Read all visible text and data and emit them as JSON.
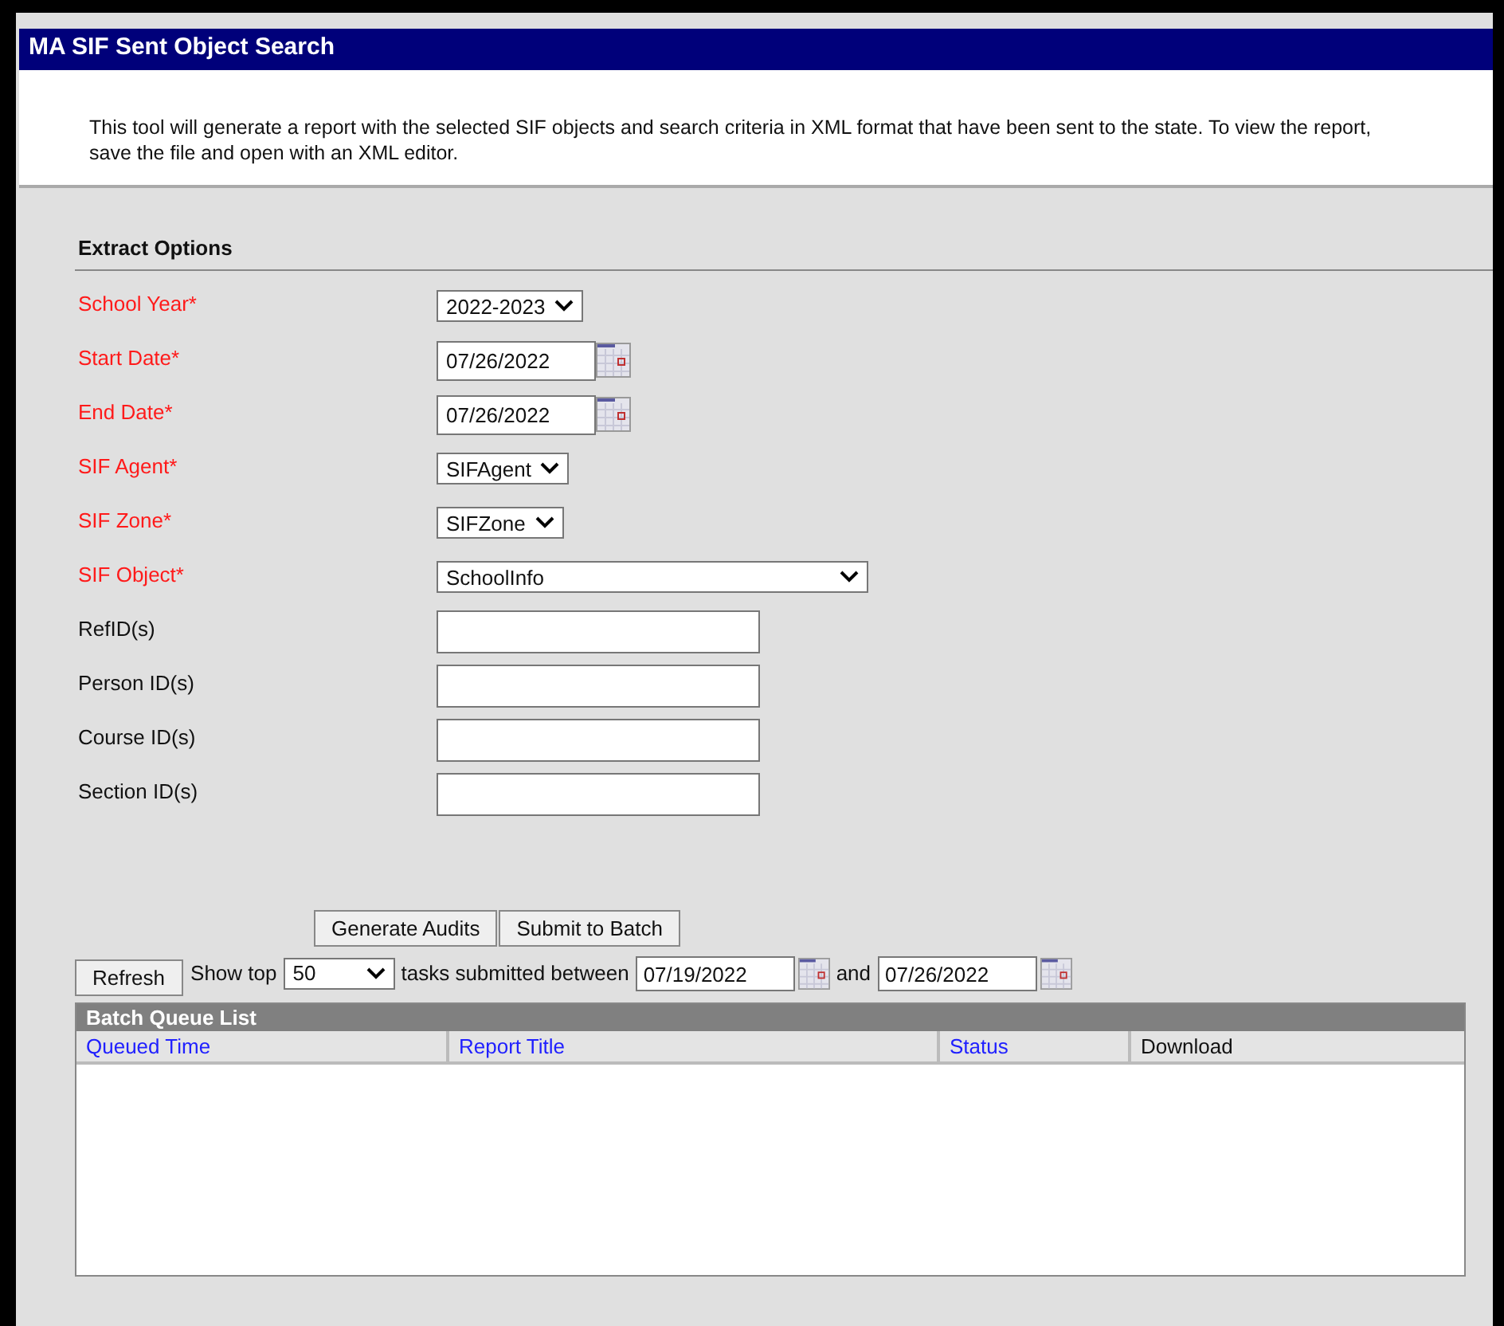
{
  "title": "MA SIF Sent Object Search",
  "description": "This tool will generate a report with the selected SIF objects and search criteria in XML format that have been sent to the state. To view the report, save the file and open with an XML editor.",
  "section_title": "Extract Options",
  "fields": [
    {
      "label": "School Year*",
      "required": true,
      "kind": "select",
      "value": "2022-2023"
    },
    {
      "label": "Start Date*",
      "required": true,
      "kind": "date",
      "value": "07/26/2022"
    },
    {
      "label": "End Date*",
      "required": true,
      "kind": "date",
      "value": "07/26/2022"
    },
    {
      "label": "SIF Agent*",
      "required": true,
      "kind": "select",
      "value": "SIFAgent"
    },
    {
      "label": "SIF Zone*",
      "required": true,
      "kind": "select",
      "value": "SIFZone"
    },
    {
      "label": "SIF Object*",
      "required": true,
      "kind": "wideselect",
      "value": "SchoolInfo"
    },
    {
      "label": "RefID(s)",
      "required": false,
      "kind": "text"
    },
    {
      "label": "Person ID(s)",
      "required": false,
      "kind": "text"
    },
    {
      "label": "Course ID(s)",
      "required": false,
      "kind": "text"
    },
    {
      "label": "Section ID(s)",
      "required": false,
      "kind": "text"
    }
  ],
  "action_buttons": [
    "Generate Audits",
    "Submit to Batch"
  ],
  "queue_filter": {
    "refresh": "Refresh",
    "show_top": "Show top",
    "count": "50",
    "between": "tasks submitted between",
    "from": "07/19/2022",
    "and": "and",
    "to": "07/26/2022"
  },
  "batch_queue": {
    "title": "Batch Queue List",
    "columns": [
      {
        "label": "Queued Time",
        "sortable": true
      },
      {
        "label": "Report Title",
        "sortable": true
      },
      {
        "label": "Status",
        "sortable": true
      },
      {
        "label": "Download",
        "sortable": false
      }
    ]
  }
}
